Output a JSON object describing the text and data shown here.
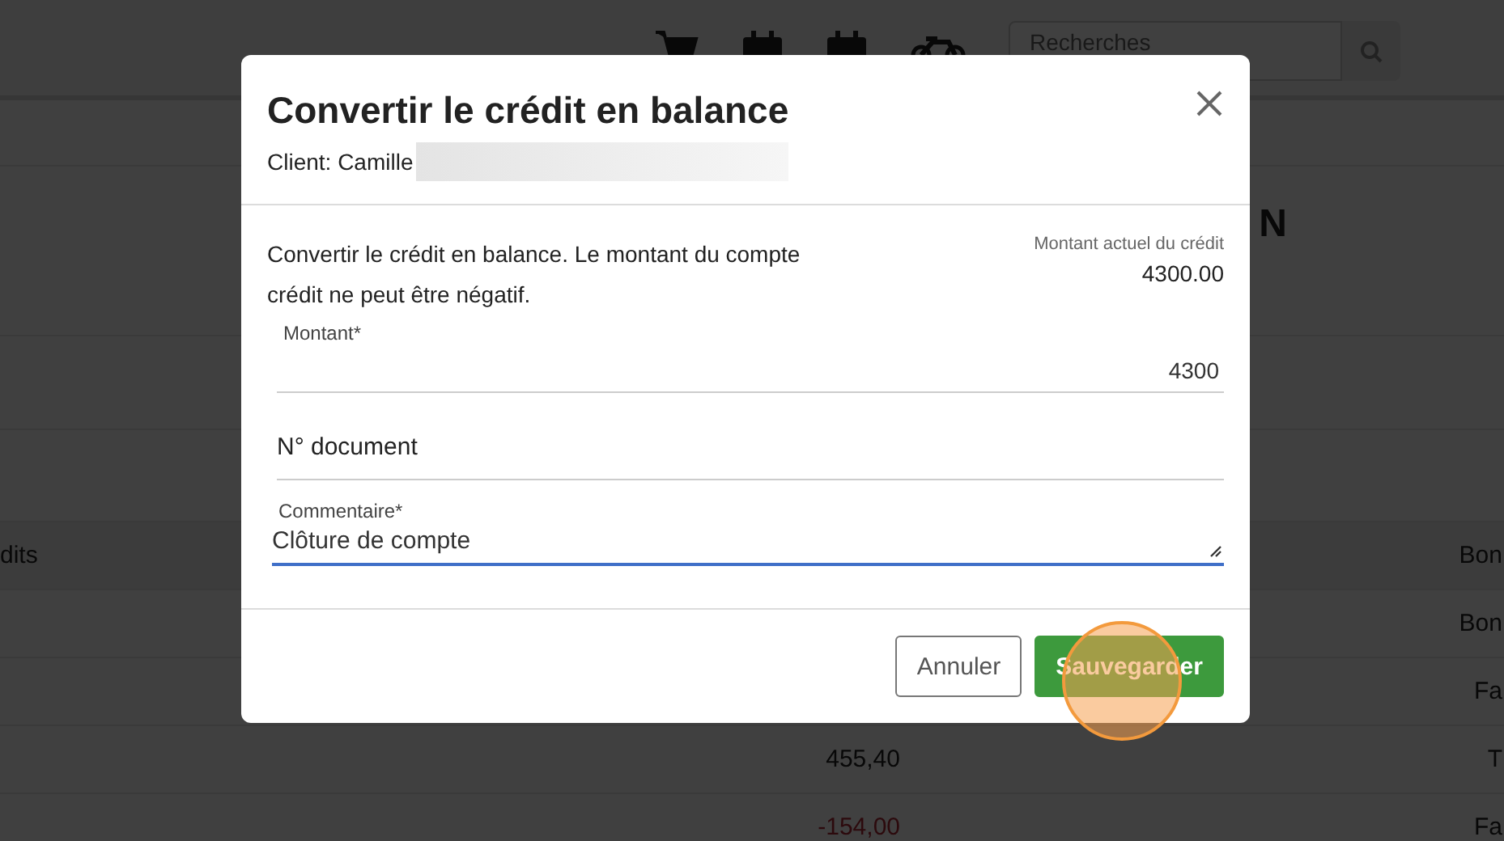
{
  "topbar": {
    "search": {
      "placeholder": "Recherches"
    }
  },
  "page": {
    "heading": "N"
  },
  "table": {
    "header": {
      "column_1": "dits",
      "column_3": "Bon"
    },
    "rows": [
      {
        "column_3": "Bon"
      },
      {
        "column_3": "Fa"
      },
      {
        "amount": {
          "text": "455,40",
          "negative": false
        },
        "column_3": "T"
      },
      {
        "amount": {
          "text": "-154,00",
          "negative": true
        },
        "column_3": "Fa"
      }
    ]
  },
  "modal": {
    "title": "Convertir le crédit en balance",
    "client": "Client: Camille",
    "description": "Convertir le crédit en balance. Le montant du compte crédit ne peut être négatif.",
    "credit": {
      "label": "Montant actuel du crédit",
      "value": "4300.00"
    },
    "fields": [
      {
        "kind": "number",
        "label": "Montant*",
        "value": "4300",
        "focused": false
      },
      {
        "kind": "text",
        "placeholder": "N° document",
        "focused": false
      },
      {
        "kind": "textarea",
        "label": "Commentaire*",
        "value": "Clôture de compte",
        "focused": true
      }
    ],
    "buttons": [
      {
        "kind": "secondary",
        "label": "Annuler"
      },
      {
        "kind": "primary",
        "label": "Sauvegarder"
      }
    ]
  }
}
